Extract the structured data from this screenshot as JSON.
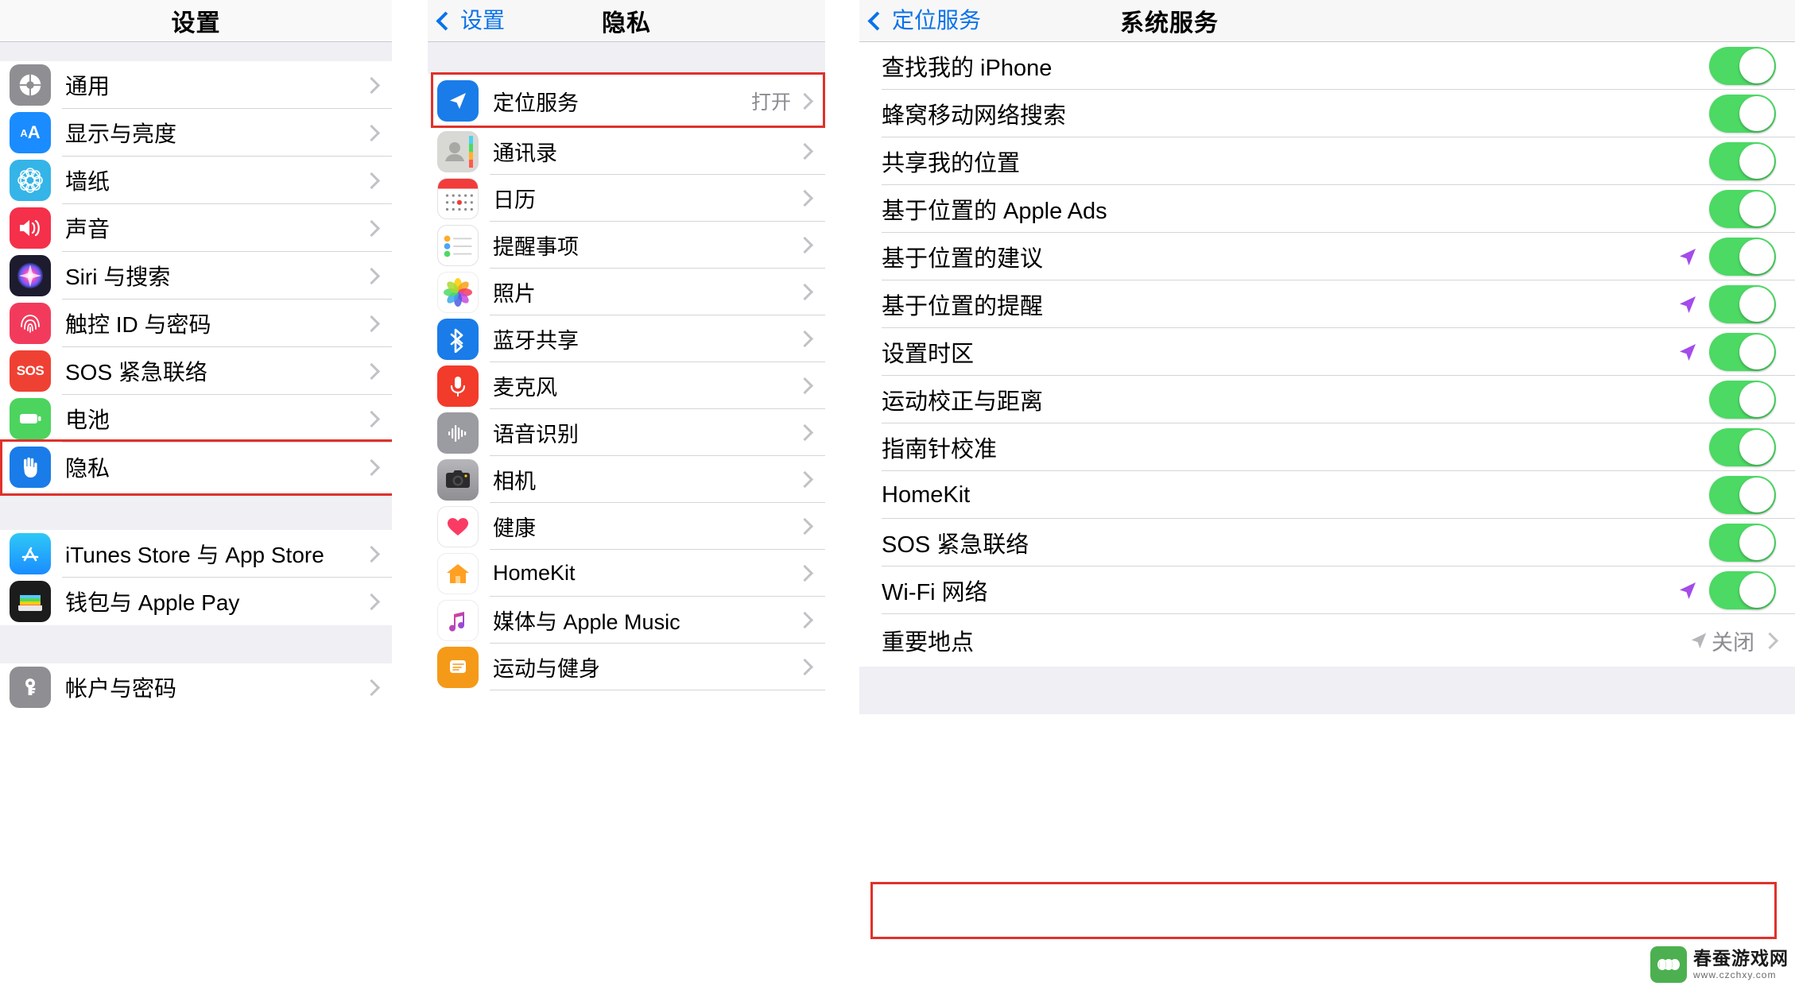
{
  "left_panel": {
    "nav": {
      "title": "设置"
    },
    "groups": [
      {
        "rows": [
          {
            "label": "通用",
            "icon": "gear-icon"
          },
          {
            "label": "显示与亮度",
            "icon": "display-brightness-icon"
          },
          {
            "label": "墙纸",
            "icon": "wallpaper-icon"
          },
          {
            "label": "声音",
            "icon": "sound-icon"
          },
          {
            "label": "Siri 与搜索",
            "icon": "siri-icon"
          },
          {
            "label": "触控 ID 与密码",
            "icon": "touch-id-icon"
          },
          {
            "label": "SOS 紧急联络",
            "icon": "sos-icon"
          },
          {
            "label": "电池",
            "icon": "battery-icon"
          },
          {
            "label": "隐私",
            "icon": "privacy-hand-icon",
            "highlighted": true
          }
        ]
      },
      {
        "rows": [
          {
            "label": "iTunes Store 与 App Store",
            "icon": "app-store-icon"
          },
          {
            "label": "钱包与 Apple Pay",
            "icon": "wallet-icon"
          }
        ]
      },
      {
        "rows": [
          {
            "label": "帐户与密码",
            "icon": "accounts-passwords-icon"
          }
        ]
      }
    ]
  },
  "mid_panel": {
    "nav": {
      "back_label": "设置",
      "title": "隐私"
    },
    "rows": [
      {
        "label": "定位服务",
        "icon": "location-services-icon",
        "value": "打开",
        "highlighted": true
      },
      {
        "label": "通讯录",
        "icon": "contacts-icon",
        "value": ""
      },
      {
        "label": "日历",
        "icon": "calendar-icon",
        "value": ""
      },
      {
        "label": "提醒事项",
        "icon": "reminders-icon",
        "value": ""
      },
      {
        "label": "照片",
        "icon": "photos-icon",
        "value": ""
      },
      {
        "label": "蓝牙共享",
        "icon": "bluetooth-icon",
        "value": ""
      },
      {
        "label": "麦克风",
        "icon": "microphone-icon",
        "value": ""
      },
      {
        "label": "语音识别",
        "icon": "speech-recognition-icon",
        "value": ""
      },
      {
        "label": "相机",
        "icon": "camera-icon",
        "value": ""
      },
      {
        "label": "健康",
        "icon": "health-icon",
        "value": ""
      },
      {
        "label": "HomeKit",
        "icon": "homekit-icon",
        "value": ""
      },
      {
        "label": "媒体与 Apple Music",
        "icon": "apple-music-icon",
        "value": ""
      },
      {
        "label": "运动与健身",
        "icon": "motion-fitness-icon",
        "value": ""
      }
    ]
  },
  "right_panel": {
    "nav": {
      "back_label": "定位服务",
      "title": "系统服务"
    },
    "rows": [
      {
        "label": "查找我的 iPhone",
        "toggle": "on",
        "arrow": false
      },
      {
        "label": "蜂窝移动网络搜索",
        "toggle": "on",
        "arrow": false
      },
      {
        "label": "共享我的位置",
        "toggle": "on",
        "arrow": false
      },
      {
        "label": "基于位置的 Apple Ads",
        "toggle": "on",
        "arrow": false
      },
      {
        "label": "基于位置的建议",
        "toggle": "on",
        "arrow": true
      },
      {
        "label": "基于位置的提醒",
        "toggle": "on",
        "arrow": true
      },
      {
        "label": "设置时区",
        "toggle": "on",
        "arrow": true
      },
      {
        "label": "运动校正与距离",
        "toggle": "on",
        "arrow": false
      },
      {
        "label": "指南针校准",
        "toggle": "on",
        "arrow": false
      },
      {
        "label": "HomeKit",
        "toggle": "on",
        "arrow": false
      },
      {
        "label": "SOS 紧急联络",
        "toggle": "on",
        "arrow": false
      },
      {
        "label": "Wi-Fi 网络",
        "toggle": "on",
        "arrow": true
      },
      {
        "label": "重要地点",
        "value": "关闭",
        "arrow_gray": true,
        "disclosure": true,
        "highlighted": true
      }
    ]
  },
  "watermark": {
    "title": "春蚕游戏网",
    "url": "www.czchxy.com"
  },
  "colors": {
    "highlight_red": "#e0312b",
    "toggle_on_green": "#4cd964",
    "nav_blue": "#0a72ea",
    "group_bg": "#efeff4",
    "arrow_purple": "#a44bea"
  }
}
